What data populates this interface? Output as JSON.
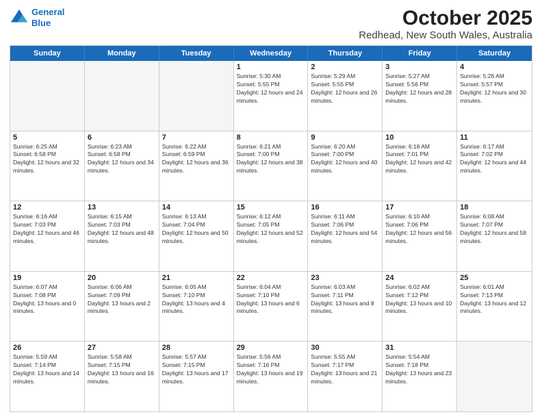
{
  "header": {
    "logo_line1": "General",
    "logo_line2": "Blue",
    "title": "October 2025",
    "subtitle": "Redhead, New South Wales, Australia"
  },
  "weekdays": [
    "Sunday",
    "Monday",
    "Tuesday",
    "Wednesday",
    "Thursday",
    "Friday",
    "Saturday"
  ],
  "rows": [
    [
      {
        "day": "",
        "sunrise": "",
        "sunset": "",
        "daylight": "",
        "empty": true
      },
      {
        "day": "",
        "sunrise": "",
        "sunset": "",
        "daylight": "",
        "empty": true
      },
      {
        "day": "",
        "sunrise": "",
        "sunset": "",
        "daylight": "",
        "empty": true
      },
      {
        "day": "1",
        "sunrise": "Sunrise: 5:30 AM",
        "sunset": "Sunset: 5:55 PM",
        "daylight": "Daylight: 12 hours and 24 minutes."
      },
      {
        "day": "2",
        "sunrise": "Sunrise: 5:29 AM",
        "sunset": "Sunset: 5:55 PM",
        "daylight": "Daylight: 12 hours and 26 minutes."
      },
      {
        "day": "3",
        "sunrise": "Sunrise: 5:27 AM",
        "sunset": "Sunset: 5:56 PM",
        "daylight": "Daylight: 12 hours and 28 minutes."
      },
      {
        "day": "4",
        "sunrise": "Sunrise: 5:26 AM",
        "sunset": "Sunset: 5:57 PM",
        "daylight": "Daylight: 12 hours and 30 minutes."
      }
    ],
    [
      {
        "day": "5",
        "sunrise": "Sunrise: 6:25 AM",
        "sunset": "Sunset: 6:58 PM",
        "daylight": "Daylight: 12 hours and 32 minutes."
      },
      {
        "day": "6",
        "sunrise": "Sunrise: 6:23 AM",
        "sunset": "Sunset: 6:58 PM",
        "daylight": "Daylight: 12 hours and 34 minutes."
      },
      {
        "day": "7",
        "sunrise": "Sunrise: 6:22 AM",
        "sunset": "Sunset: 6:59 PM",
        "daylight": "Daylight: 12 hours and 36 minutes."
      },
      {
        "day": "8",
        "sunrise": "Sunrise: 6:21 AM",
        "sunset": "Sunset: 7:00 PM",
        "daylight": "Daylight: 12 hours and 38 minutes."
      },
      {
        "day": "9",
        "sunrise": "Sunrise: 6:20 AM",
        "sunset": "Sunset: 7:00 PM",
        "daylight": "Daylight: 12 hours and 40 minutes."
      },
      {
        "day": "10",
        "sunrise": "Sunrise: 6:18 AM",
        "sunset": "Sunset: 7:01 PM",
        "daylight": "Daylight: 12 hours and 42 minutes."
      },
      {
        "day": "11",
        "sunrise": "Sunrise: 6:17 AM",
        "sunset": "Sunset: 7:02 PM",
        "daylight": "Daylight: 12 hours and 44 minutes."
      }
    ],
    [
      {
        "day": "12",
        "sunrise": "Sunrise: 6:16 AM",
        "sunset": "Sunset: 7:03 PM",
        "daylight": "Daylight: 12 hours and 46 minutes."
      },
      {
        "day": "13",
        "sunrise": "Sunrise: 6:15 AM",
        "sunset": "Sunset: 7:03 PM",
        "daylight": "Daylight: 12 hours and 48 minutes."
      },
      {
        "day": "14",
        "sunrise": "Sunrise: 6:13 AM",
        "sunset": "Sunset: 7:04 PM",
        "daylight": "Daylight: 12 hours and 50 minutes."
      },
      {
        "day": "15",
        "sunrise": "Sunrise: 6:12 AM",
        "sunset": "Sunset: 7:05 PM",
        "daylight": "Daylight: 12 hours and 52 minutes."
      },
      {
        "day": "16",
        "sunrise": "Sunrise: 6:11 AM",
        "sunset": "Sunset: 7:06 PM",
        "daylight": "Daylight: 12 hours and 54 minutes."
      },
      {
        "day": "17",
        "sunrise": "Sunrise: 6:10 AM",
        "sunset": "Sunset: 7:06 PM",
        "daylight": "Daylight: 12 hours and 56 minutes."
      },
      {
        "day": "18",
        "sunrise": "Sunrise: 6:08 AM",
        "sunset": "Sunset: 7:07 PM",
        "daylight": "Daylight: 12 hours and 58 minutes."
      }
    ],
    [
      {
        "day": "19",
        "sunrise": "Sunrise: 6:07 AM",
        "sunset": "Sunset: 7:08 PM",
        "daylight": "Daylight: 13 hours and 0 minutes."
      },
      {
        "day": "20",
        "sunrise": "Sunrise: 6:06 AM",
        "sunset": "Sunset: 7:09 PM",
        "daylight": "Daylight: 13 hours and 2 minutes."
      },
      {
        "day": "21",
        "sunrise": "Sunrise: 6:05 AM",
        "sunset": "Sunset: 7:10 PM",
        "daylight": "Daylight: 13 hours and 4 minutes."
      },
      {
        "day": "22",
        "sunrise": "Sunrise: 6:04 AM",
        "sunset": "Sunset: 7:10 PM",
        "daylight": "Daylight: 13 hours and 6 minutes."
      },
      {
        "day": "23",
        "sunrise": "Sunrise: 6:03 AM",
        "sunset": "Sunset: 7:11 PM",
        "daylight": "Daylight: 13 hours and 8 minutes."
      },
      {
        "day": "24",
        "sunrise": "Sunrise: 6:02 AM",
        "sunset": "Sunset: 7:12 PM",
        "daylight": "Daylight: 13 hours and 10 minutes."
      },
      {
        "day": "25",
        "sunrise": "Sunrise: 6:01 AM",
        "sunset": "Sunset: 7:13 PM",
        "daylight": "Daylight: 13 hours and 12 minutes."
      }
    ],
    [
      {
        "day": "26",
        "sunrise": "Sunrise: 5:59 AM",
        "sunset": "Sunset: 7:14 PM",
        "daylight": "Daylight: 13 hours and 14 minutes."
      },
      {
        "day": "27",
        "sunrise": "Sunrise: 5:58 AM",
        "sunset": "Sunset: 7:15 PM",
        "daylight": "Daylight: 13 hours and 16 minutes."
      },
      {
        "day": "28",
        "sunrise": "Sunrise: 5:57 AM",
        "sunset": "Sunset: 7:15 PM",
        "daylight": "Daylight: 13 hours and 17 minutes."
      },
      {
        "day": "29",
        "sunrise": "Sunrise: 5:56 AM",
        "sunset": "Sunset: 7:16 PM",
        "daylight": "Daylight: 13 hours and 19 minutes."
      },
      {
        "day": "30",
        "sunrise": "Sunrise: 5:55 AM",
        "sunset": "Sunset: 7:17 PM",
        "daylight": "Daylight: 13 hours and 21 minutes."
      },
      {
        "day": "31",
        "sunrise": "Sunrise: 5:54 AM",
        "sunset": "Sunset: 7:18 PM",
        "daylight": "Daylight: 13 hours and 23 minutes."
      },
      {
        "day": "",
        "sunrise": "",
        "sunset": "",
        "daylight": "",
        "empty": true
      }
    ]
  ]
}
